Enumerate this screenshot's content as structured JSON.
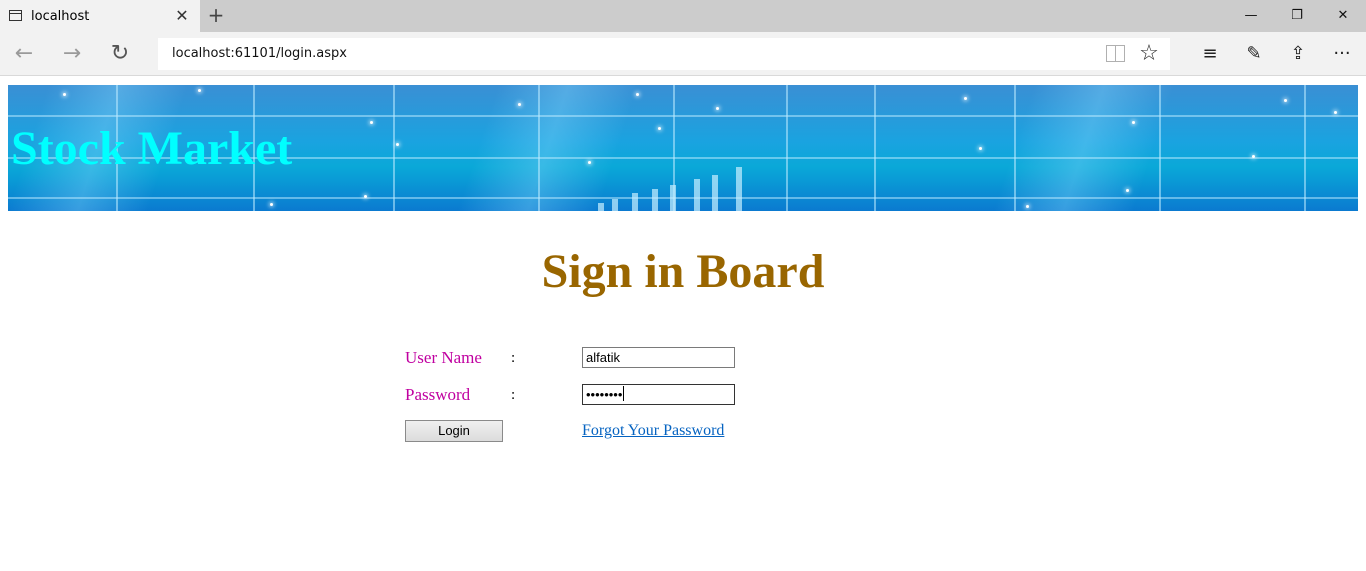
{
  "browser": {
    "tab_title": "localhost",
    "tab_close": "✕",
    "new_tab": "+",
    "url": "localhost:61101/login.aspx",
    "window_controls": {
      "minimize": "—",
      "restore": "❐",
      "close": "✕"
    },
    "nav": {
      "back": "←",
      "forward": "→",
      "refresh": "↻"
    },
    "address_icons": {
      "reading_view": "reading-view-icon",
      "favorite": "☆"
    },
    "tools": {
      "hub": "≡",
      "notes": "✎",
      "share": "⇪",
      "more": "···"
    }
  },
  "page": {
    "banner_title": "Stock Market",
    "heading": "Sign in Board",
    "form": {
      "username_label": "User Name",
      "password_label": "Password",
      "colon": ":",
      "username_value": "alfatik",
      "password_value": "••••••••",
      "login_button": "Login",
      "forgot_link": "Forgot Your Password"
    }
  },
  "colors": {
    "banner_title": "#00ffff",
    "heading": "#996600",
    "label": "#c000a0",
    "link": "#0563c1"
  }
}
